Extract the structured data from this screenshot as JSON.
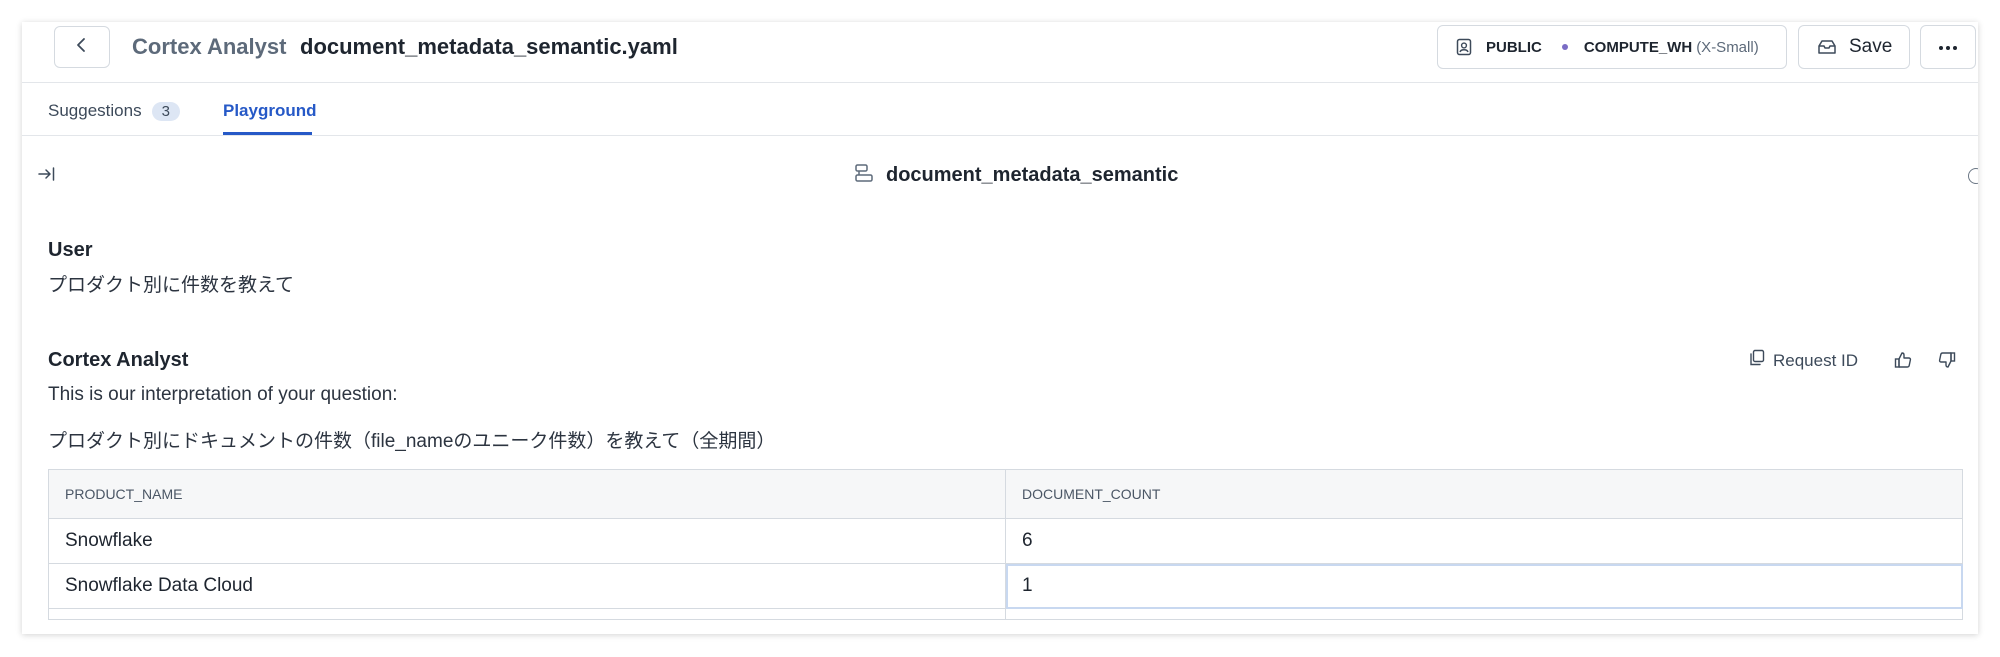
{
  "header": {
    "app_name": "Cortex Analyst",
    "file_name": "document_metadata_semantic.yaml",
    "role": "PUBLIC",
    "warehouse": "COMPUTE_WH",
    "warehouse_size": "(X-Small)",
    "save_label": "Save"
  },
  "tabs": [
    {
      "label": "Suggestions",
      "badge": "3",
      "active": false
    },
    {
      "label": "Playground",
      "active": true
    }
  ],
  "playground": {
    "model_name": "document_metadata_semantic"
  },
  "conversation": {
    "user": {
      "label": "User",
      "message": "プロダクト別に件数を教えて"
    },
    "analyst": {
      "label": "Cortex Analyst",
      "request_id_label": "Request ID",
      "interpretation_intro": "This is our interpretation of your question:",
      "interpretation": "プロダクト別にドキュメントの件数（file_nameのユニーク件数）を教えて（全期間）",
      "table": {
        "columns": [
          "PRODUCT_NAME",
          "DOCUMENT_COUNT"
        ],
        "rows": [
          [
            "Snowflake",
            "6"
          ],
          [
            "Snowflake Data Cloud",
            "1"
          ]
        ]
      }
    }
  },
  "icons": {
    "back": "chevron-left-icon",
    "role": "user-badge-icon",
    "save": "inbox-save-icon",
    "more": "more-horizontal-icon",
    "collapse": "arrow-right-to-line-icon",
    "model": "model-layers-icon",
    "copy": "copy-icon",
    "thumb_up": "thumbs-up-icon",
    "thumb_down": "thumbs-down-icon"
  },
  "colors": {
    "accent": "#2659c7",
    "badge_bg": "#dde6f4",
    "warehouse_dot": "#7a6cc5"
  }
}
